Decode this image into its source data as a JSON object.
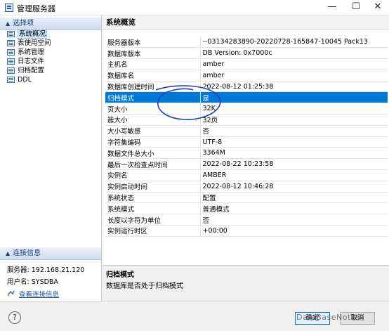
{
  "window": {
    "title": "管理服务器",
    "minimize": "—",
    "maximize": "☐",
    "close": "✕"
  },
  "sidebar": {
    "options_header": "选择项",
    "items": [
      {
        "label": "系统概况"
      },
      {
        "label": "表使用空间"
      },
      {
        "label": "系统管理"
      },
      {
        "label": "日志文件"
      },
      {
        "label": "归档配置"
      },
      {
        "label": "DDL"
      }
    ],
    "connection_header": "连接信息",
    "server_label": "服务器:",
    "server_value": "192.168.21.120",
    "user_label": "用户名:",
    "user_value": "SYSDBA",
    "link_label": "查看连接信息"
  },
  "main": {
    "title": "系统概览",
    "rows": [
      {
        "key": "服务器版本",
        "value": "--03134283890-20220728-165847-10045 Pack13"
      },
      {
        "key": "数据库版本",
        "value": "DB Version: 0x7000c"
      },
      {
        "key": "主机名",
        "value": "amber"
      },
      {
        "key": "数据库名",
        "value": "amber"
      },
      {
        "key": "数据库创建时间",
        "value": "2022-08-12 01:25:38"
      },
      {
        "key": "归档模式",
        "value": "是"
      },
      {
        "key": "页大小",
        "value": "32K"
      },
      {
        "key": "簇大小",
        "value": "32页"
      },
      {
        "key": "大小写敏感",
        "value": "否"
      },
      {
        "key": "字符集编码",
        "value": "UTF-8"
      },
      {
        "key": "数据文件总大小",
        "value": "3364M"
      },
      {
        "key": "最后一次检查点时间",
        "value": "2022-08-22 10:23:58"
      },
      {
        "key": "实例名",
        "value": "AMBER"
      },
      {
        "key": "实例启动时间",
        "value": "2022-08-12 10:46:28"
      },
      {
        "key": "系统状态",
        "value": "配置"
      },
      {
        "key": "系统模式",
        "value": "普通模式"
      },
      {
        "key": "长度以字符为单位",
        "value": "否"
      },
      {
        "key": "实例运行时区",
        "value": "+00:00"
      }
    ],
    "selected_index": 5,
    "description_title": "归档模式",
    "description_text": "数据库是否处于归档模式"
  },
  "footer": {
    "help": "?",
    "ok": "确定",
    "cancel": "取消",
    "watermark": "DataBaseNotes"
  },
  "colors": {
    "selection": "#0078d7",
    "annotation": "#1f3fc6",
    "header_text": "#1a3d7c"
  }
}
